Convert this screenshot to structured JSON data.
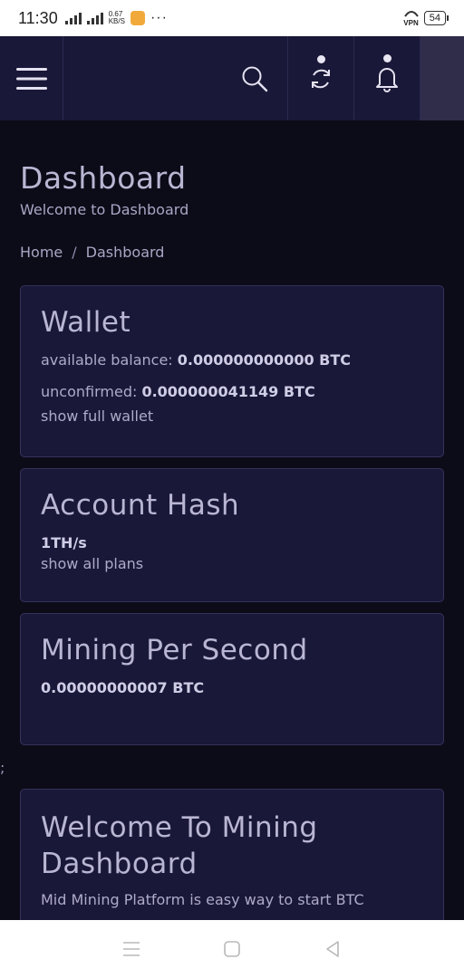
{
  "status_bar": {
    "time": "11:30",
    "net_speed_top": "0.67",
    "net_speed_unit": "KB/S",
    "signal_sup": "4G",
    "vpn": "VPN",
    "battery": "54",
    "more": "···"
  },
  "navbar": {
    "icons": [
      "hamburger-menu-icon",
      "search-icon",
      "sync-icon",
      "bell-icon"
    ]
  },
  "page": {
    "title": "Dashboard",
    "subtitle": "Welcome to Dashboard",
    "breadcrumb": {
      "home": "Home",
      "separator": "/",
      "current": "Dashboard"
    }
  },
  "wallet": {
    "title": "Wallet",
    "available_label": "available balance:",
    "available_value": "0.000000000000 BTC",
    "unconfirmed_label": "unconfirmed:",
    "unconfirmed_value": "0.000000041149 BTC",
    "link": "show full wallet"
  },
  "account_hash": {
    "title": "Account Hash",
    "value": "1TH/s",
    "link": "show all plans"
  },
  "mining": {
    "title": "Mining Per Second",
    "value": "0.00000000007 BTC"
  },
  "stray": ";",
  "welcome": {
    "title": "Welcome To Mining Dashboard",
    "text": "Mid Mining Platform is easy way to start BTC"
  },
  "system_nav": {
    "icons": [
      "recents-icon",
      "home-icon",
      "back-icon"
    ]
  }
}
